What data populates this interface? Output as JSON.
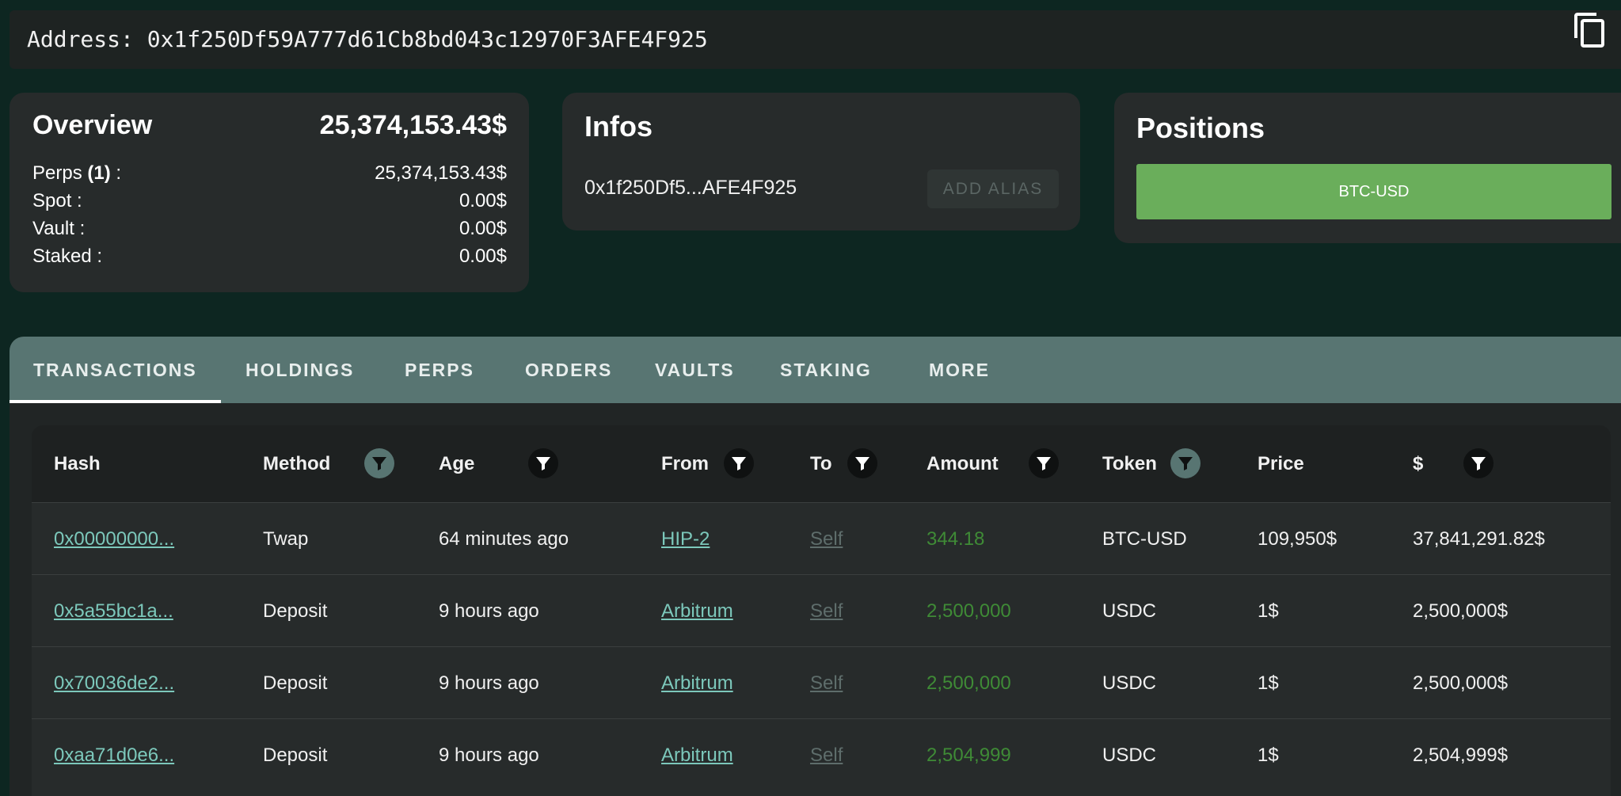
{
  "address_bar": {
    "text": "Address: 0x1f250Df59A777d61Cb8bd043c12970F3AFE4F925"
  },
  "overview": {
    "title": "Overview",
    "total": "25,374,153.43$",
    "rows": [
      {
        "label_prefix": "Perps ",
        "label_count": "(1)",
        "label_suffix": " :",
        "value": "25,374,153.43$"
      },
      {
        "label_prefix": "Spot :",
        "label_count": "",
        "label_suffix": "",
        "value": "0.00$"
      },
      {
        "label_prefix": "Vault :",
        "label_count": "",
        "label_suffix": "",
        "value": "0.00$"
      },
      {
        "label_prefix": "Staked :",
        "label_count": "",
        "label_suffix": "",
        "value": "0.00$"
      }
    ]
  },
  "infos": {
    "title": "Infos",
    "short_address": "0x1f250Df5...AFE4F925",
    "add_alias_label": "ADD ALIAS"
  },
  "positions": {
    "title": "Positions",
    "items": [
      "BTC-USD"
    ]
  },
  "tabs": [
    "TRANSACTIONS",
    "HOLDINGS",
    "PERPS",
    "ORDERS",
    "VAULTS",
    "STAKING",
    "MORE"
  ],
  "active_tab": "TRANSACTIONS",
  "table": {
    "columns": [
      "Hash",
      "Method",
      "Age",
      "From",
      "To",
      "Amount",
      "Token",
      "Price",
      "$"
    ],
    "rows": [
      {
        "hash": "0x00000000...",
        "method": "Twap",
        "age": "64 minutes ago",
        "from": "HIP-2",
        "to": "Self",
        "amount": "344.18",
        "token": "BTC-USD",
        "price": "109,950$",
        "usd": "37,841,291.82$"
      },
      {
        "hash": "0x5a55bc1a...",
        "method": "Deposit",
        "age": "9 hours ago",
        "from": "Arbitrum",
        "to": "Self",
        "amount": "2,500,000",
        "token": "USDC",
        "price": "1$",
        "usd": "2,500,000$"
      },
      {
        "hash": "0x70036de2...",
        "method": "Deposit",
        "age": "9 hours ago",
        "from": "Arbitrum",
        "to": "Self",
        "amount": "2,500,000",
        "token": "USDC",
        "price": "1$",
        "usd": "2,500,000$"
      },
      {
        "hash": "0xaa71d0e6...",
        "method": "Deposit",
        "age": "9 hours ago",
        "from": "Arbitrum",
        "to": "Self",
        "amount": "2,504,999",
        "token": "USDC",
        "price": "1$",
        "usd": "2,504,999$"
      }
    ]
  },
  "colors": {
    "background": "#0d2621",
    "card": "#272b2b",
    "tabbar": "#587572",
    "link": "#7cc8bb",
    "amount": "#3f8b36",
    "position_button": "#6aae5b"
  },
  "icons": {
    "copy": "copy-icon",
    "filter": "filter-icon"
  }
}
